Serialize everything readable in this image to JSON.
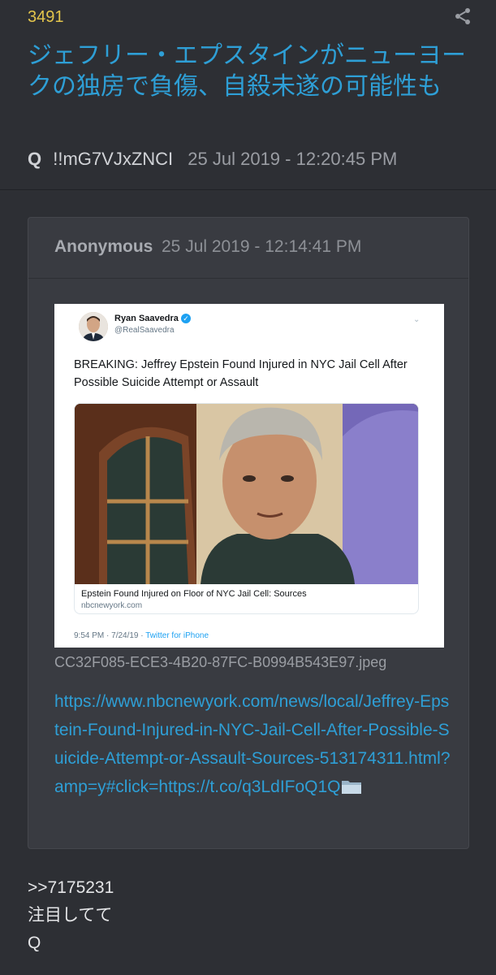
{
  "post": {
    "number": "3491",
    "title": "ジェフリー・エプスタインがニューヨークの独房で負傷、自殺未遂の可能性も",
    "author": "Q",
    "tripcode": "!!mG7VJxZNCI",
    "timestamp": "25 Jul 2019 - 12:20:45 PM",
    "share_icon": "share-icon"
  },
  "quote": {
    "author": "Anonymous",
    "timestamp": "25 Jul 2019 - 12:14:41 PM",
    "tweet": {
      "name": "Ryan Saavedra",
      "handle": "@RealSaavedra",
      "text": "BREAKING: Jeffrey Epstein Found Injured in NYC Jail Cell After Possible Suicide Attempt or Assault",
      "card_title": "Epstein Found Injured on Floor of NYC Jail Cell: Sources",
      "card_domain": "nbcnewyork.com",
      "time": "9:54 PM · 7/24/19 · ",
      "source": "Twitter for iPhone"
    },
    "filename": "CC32F085-ECE3-4B20-87FC-B0994B543E97.jpeg",
    "link": "https://www.nbcnewyork.com/news/local/Jeffrey-Epstein-Found-Injured-in-NYC-Jail-Cell-After-Possible-Suicide-Attempt-or-Assault-Sources-513174311.html?amp=y#click=https://t.co/q3LdIFoQ1Q"
  },
  "reply": {
    "ref": ">>7175231",
    "line2": "注目してて",
    "signature": "Q"
  },
  "colors": {
    "background": "#2d2f34",
    "accent_blue": "#2e9fd6",
    "post_number": "#e3c54c"
  }
}
